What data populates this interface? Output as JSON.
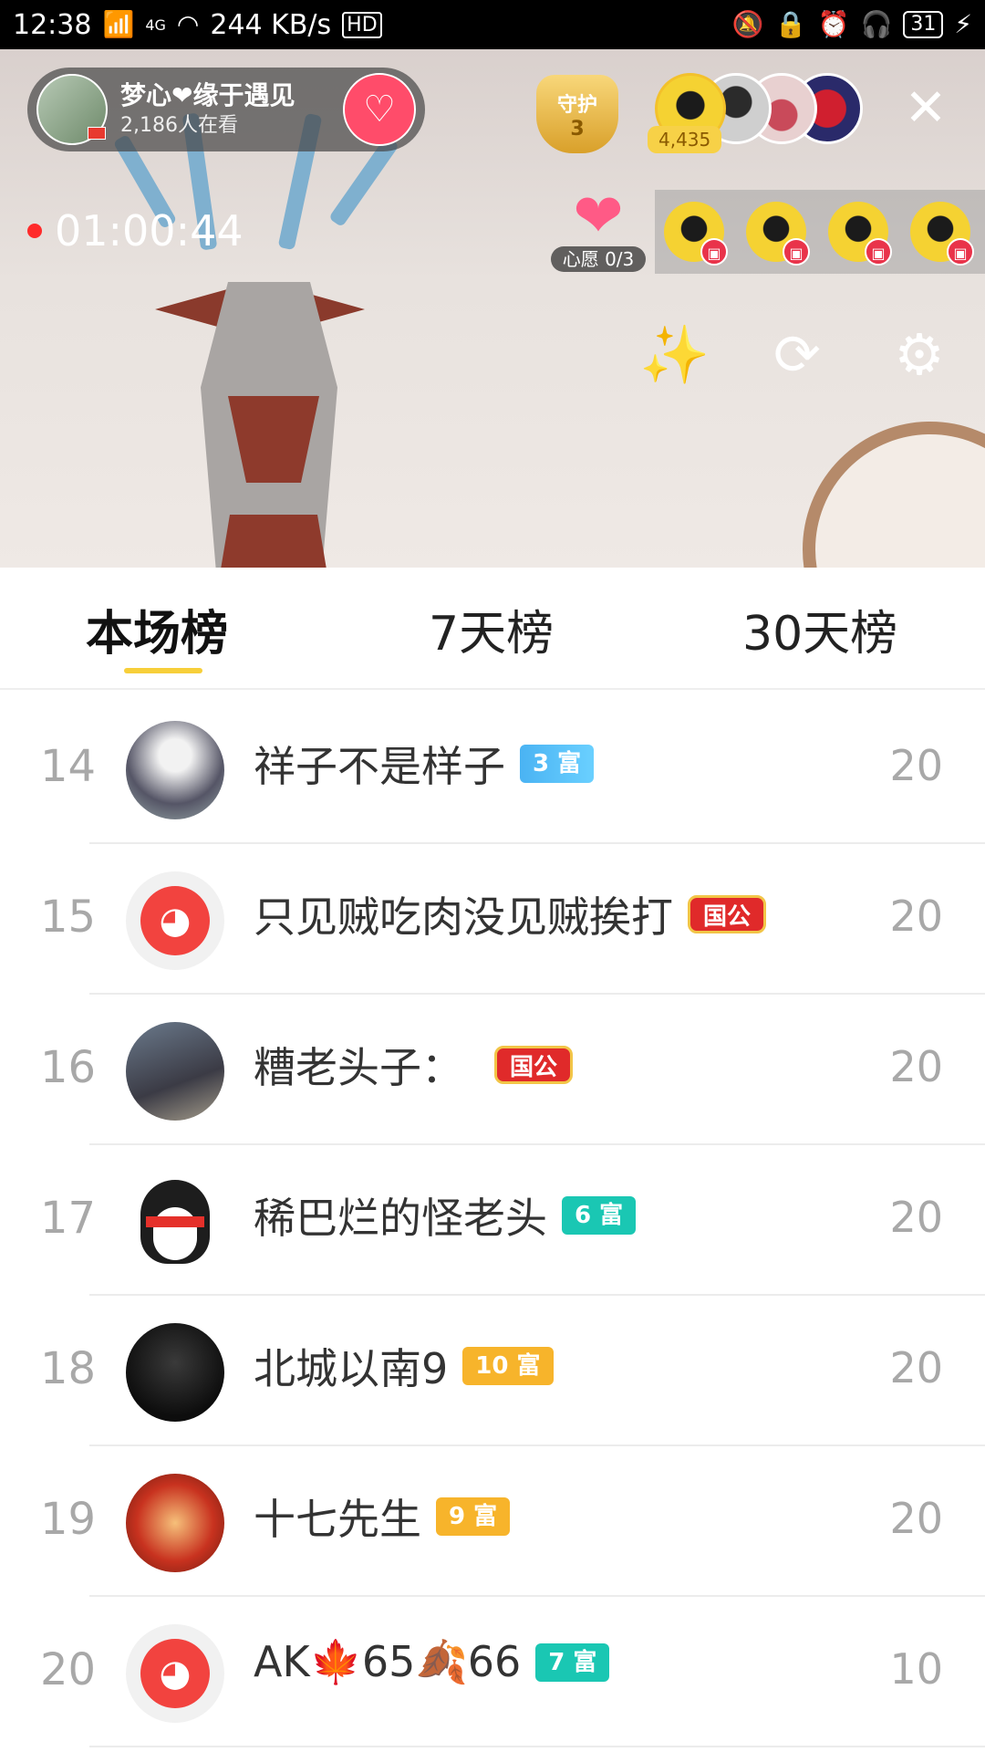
{
  "status_bar": {
    "time": "12:38",
    "network_type": "4G",
    "speed": "244 KB/s",
    "hd": "HD",
    "battery": "31"
  },
  "stream": {
    "host_name": "梦心❤缘于遇见",
    "viewers": "2,186人在看",
    "guard_label": "守护",
    "guard_count": "3",
    "audience_count": "4,435",
    "live_time": "01:00:44",
    "wish_label": "心愿 0/3"
  },
  "tabs": [
    "本场榜",
    "7天榜",
    "30天榜"
  ],
  "rows": [
    {
      "rank": "14",
      "name": "祥子不是样子",
      "badge": "3 富",
      "score": "20"
    },
    {
      "rank": "15",
      "name": "只见贼吃肉没见贼挨打",
      "badge": "国公",
      "score": "20"
    },
    {
      "rank": "16",
      "name": "糟老头子：",
      "badge": "国公",
      "score": "20"
    },
    {
      "rank": "17",
      "name": "稀巴烂的怪老头",
      "badge": "6 富",
      "score": "20"
    },
    {
      "rank": "18",
      "name": "北城以南9",
      "badge": "10 富",
      "score": "20"
    },
    {
      "rank": "19",
      "name": "十七先生",
      "badge": "9 富",
      "score": "20"
    },
    {
      "rank": "20",
      "name": "AK🍁65🍂66",
      "badge": "7 富",
      "score": "10"
    }
  ],
  "colors": {
    "tab_indicator": "#f7cf3a",
    "follow_button": "#ff4c6a",
    "live_dot": "#ff2b2b"
  }
}
